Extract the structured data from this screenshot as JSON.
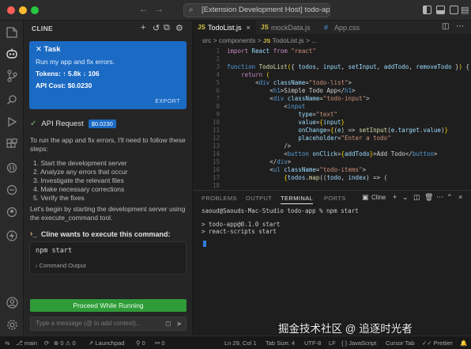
{
  "window": {
    "title": "[Extension Development Host] todo-app"
  },
  "sidebar": {
    "title": "CLINE",
    "task": {
      "label": "Task",
      "description": "Run my app and fix errors.",
      "tokens": "Tokens: ↑ 5.8k ↓ 106",
      "api_cost": "API Cost: $0.0230",
      "export": "EXPORT"
    },
    "api_request": {
      "label": "API Request",
      "cost": "$0.0230"
    },
    "intro": "To run the app and fix errors, I'll need to follow these steps:",
    "steps": [
      "1. Start the development server",
      "2. Analyze any errors that occur",
      "3. Investigate the relevant files",
      "4. Make necessary corrections",
      "5. Verify the fixes"
    ],
    "begin_text": "Let's begin by starting the development server using the execute_command tool.",
    "execute_label": "Cline wants to execute this command:",
    "command": "npm start",
    "command_output": "Command Output",
    "proceed_button": "Proceed While Running",
    "message_placeholder": "Type a message (@ to add context)..."
  },
  "tabs": [
    {
      "label": "TodoList.js",
      "type": "js",
      "active": true
    },
    {
      "label": "mockData.js",
      "type": "js",
      "active": false
    },
    {
      "label": "App.css",
      "type": "css",
      "active": false
    }
  ],
  "breadcrumb": {
    "parts": "src > components >",
    "file": "TodoList.js",
    "tail": "> ..."
  },
  "editor_line_numbers": [
    "1",
    "2",
    "3",
    "4",
    "5",
    "6",
    "7",
    "8",
    "9",
    "10",
    "11",
    "12",
    "13",
    "14",
    "15",
    "16",
    "17",
    "18"
  ],
  "panel": {
    "tabs": [
      "PROBLEMS",
      "OUTPUT",
      "TERMINAL",
      "PORTS"
    ],
    "terminal_name": "Cline",
    "prompt": "saoud@Saouds-Mac-Studio todo-app % npm start",
    "output": [
      "> todo-app@0.1.0 start",
      "> react-scripts start"
    ]
  },
  "statusbar": {
    "branch": "main",
    "errors": "0",
    "warnings": "0",
    "launchpad": "Launchpad",
    "ports": "0",
    "ws": "0",
    "position": "Ln 29, Col 1",
    "tab_size": "Tab Size: 4",
    "encoding": "UTF-8",
    "eol": "LF",
    "language": "JavaScript",
    "tab_mode": "Cursor Tab",
    "prettier": "Prettier"
  },
  "watermark": "掘金技术社区 @ 追逐时光者",
  "colors": {
    "accent": "#1b6ac4",
    "proceed": "#2f9b39",
    "keyword": "#c586c0",
    "string": "#ce9178"
  }
}
